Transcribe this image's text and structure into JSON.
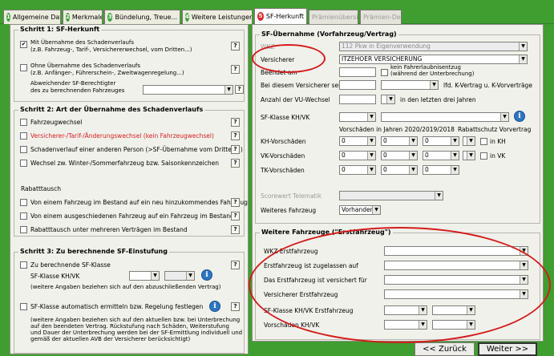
{
  "tabs": [
    {
      "num": "1",
      "label": "Allgemeine Daten",
      "state": "normal",
      "color": "green"
    },
    {
      "num": "2",
      "label": "Merkmale",
      "state": "normal",
      "color": "green"
    },
    {
      "num": "3",
      "label": "Bündelung, Treue...",
      "state": "normal",
      "color": "green"
    },
    {
      "num": "4",
      "label": "Weitere Leistungen",
      "state": "normal",
      "color": "green"
    },
    {
      "num": "5",
      "label": "SF-Herkunft",
      "state": "active",
      "color": "red"
    },
    {
      "num": "",
      "label": "Prämienübersicht",
      "state": "disabled"
    },
    {
      "num": "",
      "label": "Prämien-Detail",
      "state": "disabled"
    }
  ],
  "schritt1": {
    "title": "Schritt 1: SF-Herkunft",
    "opt1": "Mit Übernahme des Schadenverlaufs",
    "opt1_sub": "(z.B. Fahrzeug-, Tarif-, Versichererwechsel, vom Dritten...)",
    "opt2": "Ohne Übernahme des Schadenverlaufs",
    "opt2_sub": "(z.B. Anfänger-, Führerschein-, Zweitwagenregelung...)",
    "abw1": "Abweichender SF-Berechtigter",
    "abw2": "des zu berechnenden Fahrzeuges"
  },
  "schritt2": {
    "title": "Schritt 2: Art der Übernahme des Schadenverlaufs",
    "items": [
      "Fahrzeugwechsel",
      "Versicherer-/Tarif-/Änderungswechsel (kein Fahrzeugwechsel)",
      "Schadenverlauf einer anderen Person (>SF-Übernahme vom Dritten<)",
      "Wechsel zw. Winter-/Sommerfahrzeug bzw. Saisonkennzeichen"
    ],
    "rabatt_title": "Rabatttausch",
    "rabatt_items": [
      "Von einem Fahrzeug im Bestand auf ein neu hinzukommendes Fahrzeug",
      "Von einem ausgeschiedenen Fahrzeug auf ein Fahrzeug im Bestand",
      "Rabatttausch unter mehreren Verträgen im Bestand"
    ]
  },
  "schritt3": {
    "title": "Schritt 3: Zu berechnende SF-Einstufung",
    "cb1": "Zu berechnende SF-Klasse",
    "sfk": "SF-Klasse KH/VK",
    "note1": "(weitere Angaben beziehen sich auf den abzuschließenden Vertrag)",
    "cb2": "SF-Klasse automatisch ermitteln bzw. Regelung festlegen",
    "note2_1": "(weitere Angaben beziehen sich auf den aktuellen bzw. bei Unterbrechung",
    "note2_2": "auf den beendeten Vertrag. Rückstufung nach Schäden, Weiterstufung",
    "note2_3": "und Dauer der Unterbrechung werden bei der SF-Ermittlung individuell und",
    "note2_4": "gemäß der aktuellen AVB der Versicherer berücksichtigt)"
  },
  "sf_uebernahme": {
    "title": "SF-Übernahme (Vorfahrzeug/Vertrag)",
    "wkz_label": "WKZ",
    "wkz_value": "112 Pkw in Eigenverwendung",
    "versicherer_label": "Versicherer",
    "versicherer_value": "ITZEHOER VERSICHERUNG",
    "beendet_label": "Beendet am",
    "kein_fahrer1": "kein Fahrerlaubnisentzug",
    "kein_fahrer2": "(während der Unterbrechung)",
    "bei_label": "Bei diesem Versicherer seit",
    "lfd": "lfd. K-Vertrag u. K-Vorverträge",
    "anzahl_label": "Anzahl der VU-Wechsel",
    "in_den_label": "in den letzten drei Jahren",
    "sfk_label": "SF-Klasse KH/VK",
    "vorschaeden_hdr": "Vorschäden in Jahren 2020/2019/2018",
    "rabattschutz_hdr": "Rabattschutz Vorvertrag",
    "kh_label": "KH-Vorschäden",
    "vk_label": "VK-Vorschäden",
    "tk_label": "TK-Vorschäden",
    "zero": "0",
    "in_kh": "in KH",
    "in_vk": "in VK",
    "score_label": "Scorewert Telematik",
    "weiteres_label": "Weiteres Fahrzeug",
    "weiteres_value": "Vorhanden"
  },
  "weitere": {
    "title": "Weitere Fahrzeuge (\"Erstfahrzeug\")",
    "wkz": "WKZ Erstfahrzeug",
    "zugelassen": "Erstfahrzeug ist zugelassen auf",
    "versichert": "Das Erstfahrzeug ist versichert für",
    "versicherer": "Versicherer Erstfahrzeug",
    "sfk": "SF-Klasse KH/VK Erstfahrzeug",
    "vorschaeden": "Vorschäden KH/VK"
  },
  "nav": {
    "back": "<< Zurück",
    "next": "Weiter >>"
  },
  "colors": {
    "bg_green": "#3f9e2f",
    "annotation_red": "#d21c1c",
    "info_blue": "#2d76c4"
  },
  "icons": {
    "help": "question-icon",
    "info": "info-icon",
    "dropdown": "chevron-down-icon"
  }
}
